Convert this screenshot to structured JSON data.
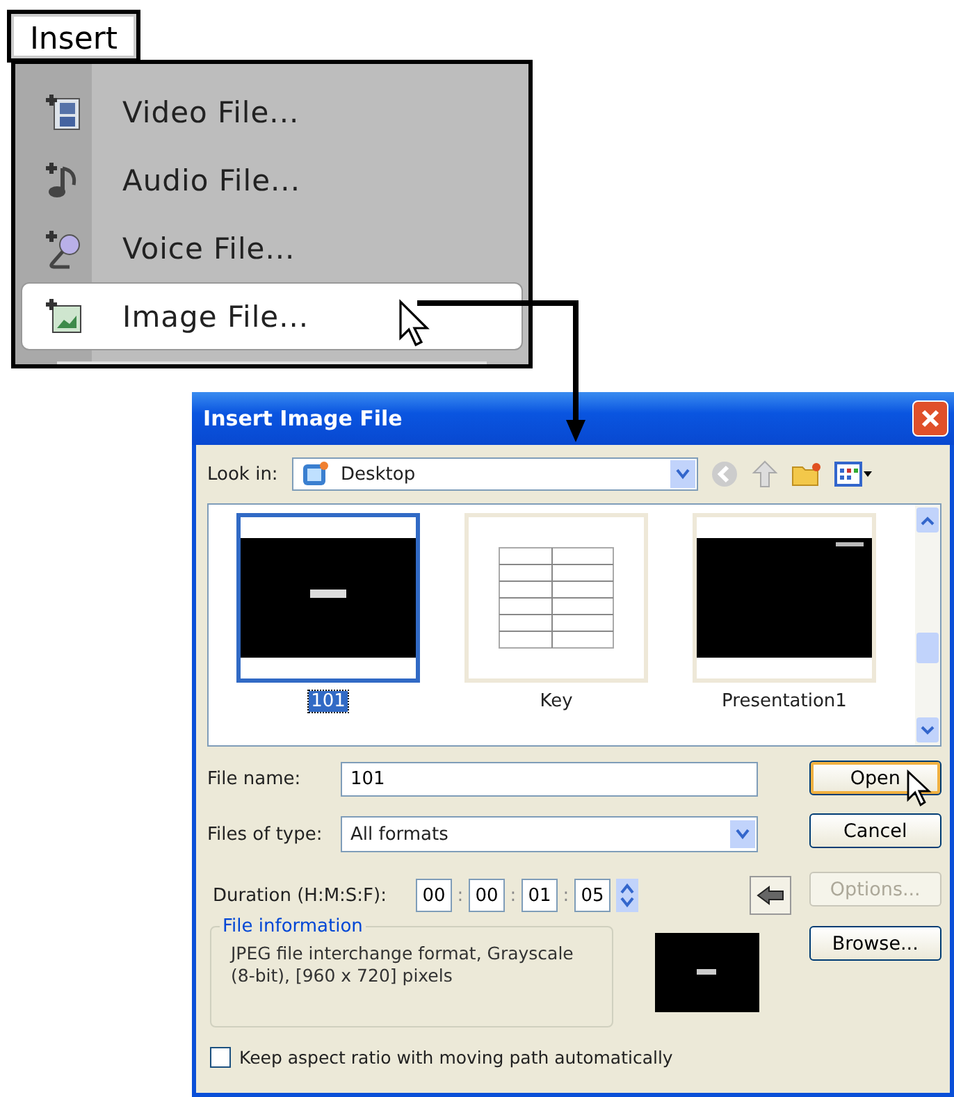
{
  "menu": {
    "title": "Insert",
    "items": [
      {
        "label": "Video File...",
        "selected": false
      },
      {
        "label": "Audio File...",
        "selected": false
      },
      {
        "label": "Voice File...",
        "selected": false
      },
      {
        "label": "Image File...",
        "selected": true
      }
    ]
  },
  "dialog": {
    "title": "Insert Image File",
    "look_in": {
      "label": "Look in:",
      "value": "Desktop"
    },
    "files": [
      {
        "name": "101",
        "kind": "dark",
        "selected": true
      },
      {
        "name": "Key",
        "kind": "table",
        "selected": false
      },
      {
        "name": "Presentation1",
        "kind": "dark",
        "selected": false
      }
    ],
    "file_name": {
      "label": "File name:",
      "value": "101"
    },
    "file_type": {
      "label": "Files of type:",
      "value": "All formats"
    },
    "duration": {
      "label": "Duration (H:M:S:F):",
      "separator": ":",
      "fields": [
        "00",
        "00",
        "01",
        "05"
      ]
    },
    "file_info": {
      "legend": "File information",
      "text": "JPEG file interchange format,  Grayscale (8-bit),  [960 x 720] pixels"
    },
    "buttons": [
      {
        "label": "Open",
        "focused": true,
        "disabled": false
      },
      {
        "label": "Cancel",
        "focused": false,
        "disabled": false
      },
      {
        "label": "Options...",
        "focused": false,
        "disabled": true
      },
      {
        "label": "Browse...",
        "focused": false,
        "disabled": false
      }
    ],
    "keep_aspect": {
      "label": "Keep aspect ratio with moving path automatically",
      "checked": false
    }
  }
}
